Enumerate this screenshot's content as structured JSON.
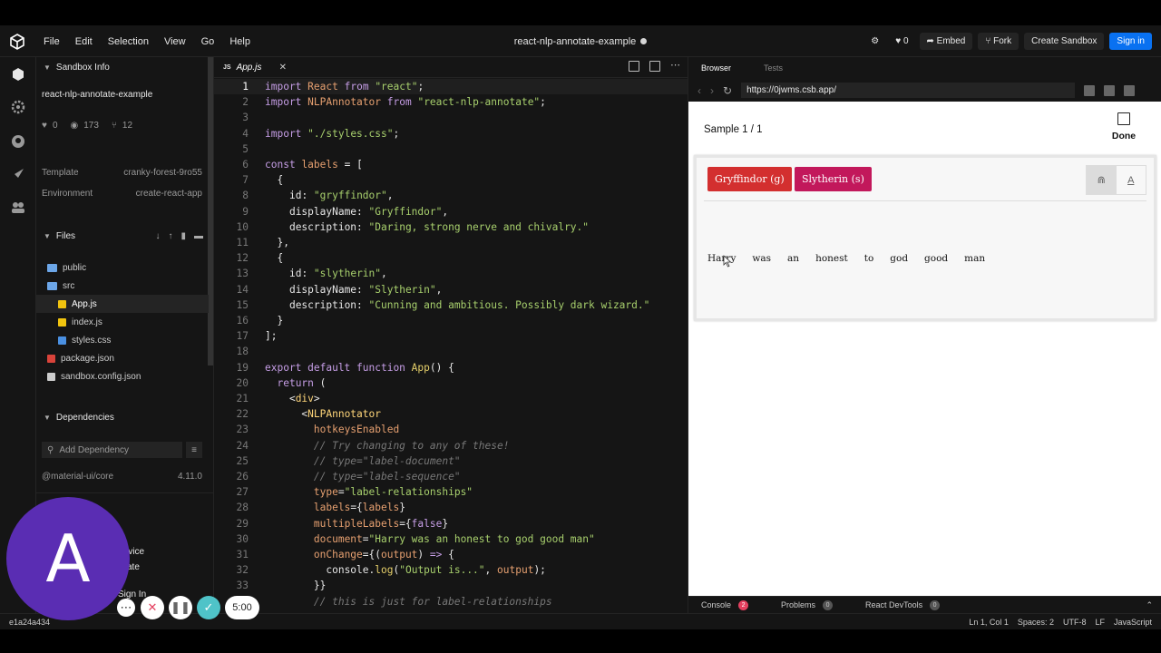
{
  "menubar": {
    "items": [
      "File",
      "Edit",
      "Selection",
      "View",
      "Go",
      "Help"
    ],
    "title": "react-nlp-annotate-example",
    "like_count": "0",
    "embed_label": "Embed",
    "fork_label": "Fork",
    "create_label": "Create Sandbox",
    "signin_label": "Sign in"
  },
  "sidebar": {
    "info_header": "Sandbox Info",
    "project_name": "react-nlp-annotate-example",
    "likes": "0",
    "views": "173",
    "forks": "12",
    "template_label": "Template",
    "template_value": "cranky-forest-9ro55",
    "environment_label": "Environment",
    "environment_value": "create-react-app",
    "files_header": "Files",
    "files": [
      "public",
      "src",
      "App.js",
      "index.js",
      "styles.css",
      "package.json",
      "sandbox.config.json"
    ],
    "dependencies_header": "Dependencies",
    "add_dependency_placeholder": "Add Dependency",
    "dependency_name": "@material-ui/core",
    "dependency_version": "4.11.0",
    "partial_1": "rvice",
    "partial_2": "ate",
    "partial_3": "Sign In"
  },
  "editor": {
    "tab_label": "App.js",
    "tab_lang": "JS",
    "lines": [
      "1",
      "2",
      "3",
      "4",
      "5",
      "6",
      "7",
      "8",
      "9",
      "10",
      "11",
      "12",
      "13",
      "14",
      "15",
      "16",
      "17",
      "18",
      "19",
      "20",
      "21",
      "22",
      "23",
      "24",
      "25",
      "26",
      "27",
      "28",
      "29",
      "30",
      "31",
      "32",
      "33",
      "34"
    ]
  },
  "browser": {
    "tab_browser": "Browser",
    "tab_tests": "Tests",
    "url": "https://0jwms.csb.app/",
    "sample_label": "Sample 1 / 1",
    "done_label": "Done",
    "label_1": "Gryffindor (g)",
    "label_2": "Slytherin (s)",
    "label_1_color": "#d32f2f",
    "label_2_color": "#c2185b",
    "words": [
      "Harry",
      "was",
      "an",
      "honest",
      "to",
      "god",
      "good",
      "man"
    ],
    "bottom_tabs": [
      "Console",
      "Problems",
      "React DevTools"
    ],
    "console_count": "2",
    "problems_count": "0",
    "devtools_count": "0"
  },
  "statusbar": {
    "commit": "e1a24a434",
    "position": "Ln 1, Col 1",
    "spaces": "Spaces: 2",
    "encoding": "UTF-8",
    "eol": "LF",
    "language": "JavaScript"
  },
  "recorder": {
    "avatar_letter": "A",
    "timer": "5:00"
  }
}
